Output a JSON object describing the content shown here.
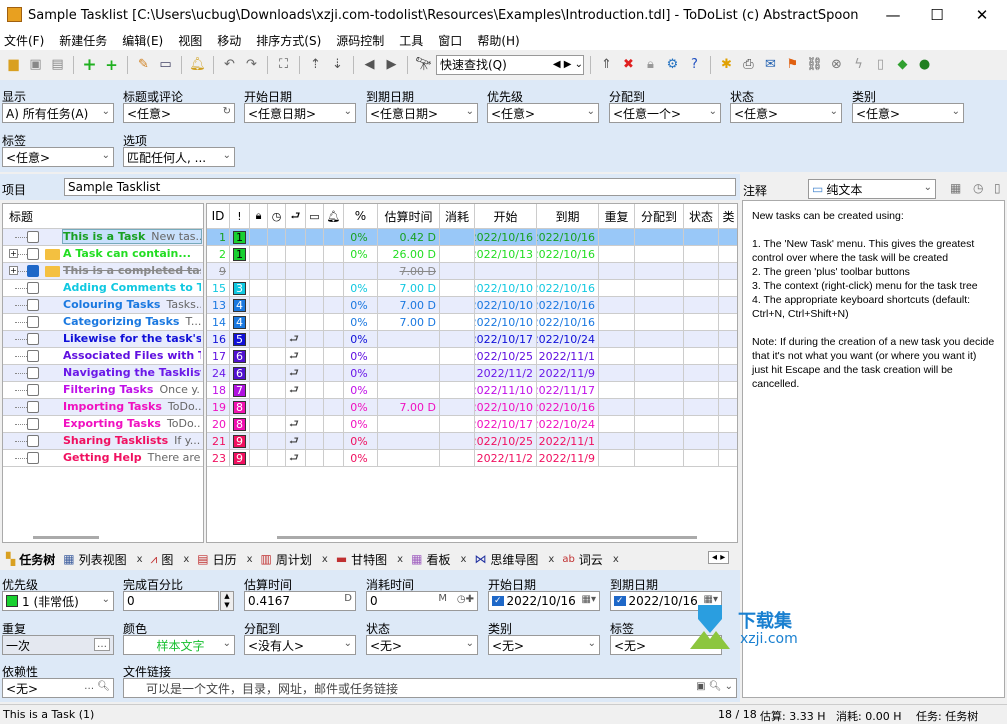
{
  "window": {
    "title": "Sample Tasklist [C:\\Users\\ucbug\\Downloads\\xzji.com-todolist\\Resources\\Examples\\Introduction.tdl] - ToDoList (c) AbstractSpoon"
  },
  "menu": [
    "文件(F)",
    "新建任务",
    "编辑(E)",
    "视图",
    "移动",
    "排序方式(S)",
    "源码控制",
    "工具",
    "窗口",
    "帮助(H)"
  ],
  "toolbar": {
    "quick_find": "快速查找(Q)"
  },
  "filters": [
    {
      "label": "显示",
      "value": "A)  所有任务(A)"
    },
    {
      "label": "标题或评论",
      "value": "<任意>"
    },
    {
      "label": "开始日期",
      "value": "<任意日期>"
    },
    {
      "label": "到期日期",
      "value": "<任意日期>"
    },
    {
      "label": "优先级",
      "value": "<任意>"
    },
    {
      "label": "分配到",
      "value": "<任意一个>"
    },
    {
      "label": "状态",
      "value": "<任意>"
    },
    {
      "label": "类别",
      "value": "<任意>"
    },
    {
      "label": "标签",
      "value": "<任意>"
    },
    {
      "label": "选项",
      "value": "匹配任何人, ..."
    }
  ],
  "project": {
    "label": "项目",
    "value": "Sample Tasklist"
  },
  "comments": {
    "label": "注释",
    "format": "纯文本",
    "text": "New tasks can be created using:\n\n1. The 'New Task' menu. This gives the greatest control over where the task will be created\n2. The green 'plus' toolbar buttons\n3. The context (right-click) menu for the task tree\n4. The appropriate keyboard shortcuts (default: Ctrl+N, Ctrl+Shift+N)\n\nNote: If during the creation of a new task you decide that it's not what you want (or where you want it) just hit Escape and the task creation will be cancelled."
  },
  "tree_header": "标题",
  "columns": [
    "ID",
    "!",
    "lock",
    "clock",
    "dep",
    "folder",
    "bell",
    "%",
    "估算时间",
    "消耗",
    "开始",
    "到期",
    "重复",
    "分配到",
    "状态",
    "类"
  ],
  "tasks": [
    {
      "title": "This is a Task",
      "comment": "New tas...",
      "id": "1",
      "priority": "1",
      "pct": "0%",
      "est": "0.42 D",
      "start": "2022/10/16",
      "due": "2022/10/16",
      "color": "#18a020",
      "pcolor": "#18d030",
      "selected": true
    },
    {
      "title": "A Task can contain...",
      "comment": "",
      "id": "2",
      "priority": "1",
      "pct": "0%",
      "est": "26.00 D",
      "start": "2022/10/13",
      "due": "2022/10/16",
      "color": "#22dd22",
      "pcolor": "#18d030",
      "folder": true,
      "expand": true
    },
    {
      "title": "This is a completed task",
      "comment": "",
      "id": "9",
      "priority": "",
      "pct": "",
      "est": "7.00 D",
      "start": "",
      "due": "",
      "color": "#888888",
      "done": true,
      "folder": true,
      "expand": true
    },
    {
      "title": "Adding Comments to T...",
      "comment": "",
      "id": "15",
      "priority": "3",
      "pct": "0%",
      "est": "7.00 D",
      "start": "2022/10/10",
      "due": "2022/10/16",
      "color": "#10c8e0",
      "pcolor": "#10c8e0"
    },
    {
      "title": "Colouring Tasks",
      "comment": "Tasks...",
      "id": "13",
      "priority": "4",
      "pct": "0%",
      "est": "7.00 D",
      "start": "2022/10/10",
      "due": "2022/10/16",
      "color": "#1a78e0",
      "pcolor": "#1a78e0"
    },
    {
      "title": "Categorizing Tasks",
      "comment": "T...",
      "id": "14",
      "priority": "4",
      "pct": "0%",
      "est": "7.00 D",
      "start": "2022/10/10",
      "due": "2022/10/16",
      "color": "#1a78e0",
      "pcolor": "#1a78e0"
    },
    {
      "title": "Likewise for the task's ...",
      "comment": "",
      "id": "16",
      "priority": "5",
      "pct": "0%",
      "est": "",
      "start": "2022/10/17",
      "due": "2022/10/24",
      "color": "#1010d8",
      "pcolor": "#1010d8",
      "dep": true
    },
    {
      "title": "Associated Files with T...",
      "comment": "",
      "id": "17",
      "priority": "6",
      "pct": "0%",
      "est": "",
      "start": "2022/10/25",
      "due": "2022/11/1",
      "color": "#6010e0",
      "pcolor": "#5010d0",
      "dep": true
    },
    {
      "title": "Navigating the Tasklist",
      "comment": "",
      "id": "24",
      "priority": "6",
      "pct": "0%",
      "est": "",
      "start": "2022/11/2",
      "due": "2022/11/9",
      "color": "#6a18e8",
      "pcolor": "#5010d0",
      "dep": true
    },
    {
      "title": "Filtering Tasks",
      "comment": "Once y...",
      "id": "18",
      "priority": "7",
      "pct": "0%",
      "est": "",
      "start": "2022/11/10",
      "due": "2022/11/17",
      "color": "#c010e8",
      "pcolor": "#b010e0",
      "dep": true
    },
    {
      "title": "Importing Tasks",
      "comment": "ToDo...",
      "id": "19",
      "priority": "8",
      "pct": "0%",
      "est": "7.00 D",
      "start": "2022/10/10",
      "due": "2022/10/16",
      "color": "#f010c0",
      "pcolor": "#f010b0"
    },
    {
      "title": "Exporting Tasks",
      "comment": "ToDo...",
      "id": "20",
      "priority": "8",
      "pct": "0%",
      "est": "",
      "start": "2022/10/17",
      "due": "2022/10/24",
      "color": "#f010c0",
      "pcolor": "#f010b0",
      "dep": true
    },
    {
      "title": "Sharing Tasklists",
      "comment": "If y...",
      "id": "21",
      "priority": "9",
      "pct": "0%",
      "est": "",
      "start": "2022/10/25",
      "due": "2022/11/1",
      "color": "#f01060",
      "pcolor": "#f01060",
      "dep": true
    },
    {
      "title": "Getting Help",
      "comment": "There are...",
      "id": "23",
      "priority": "9",
      "pct": "0%",
      "est": "",
      "start": "2022/11/2",
      "due": "2022/11/9",
      "color": "#f01060",
      "pcolor": "#f01060",
      "dep": true
    }
  ],
  "tabs": [
    "任务树",
    "列表视图",
    "图",
    "日历",
    "周计划",
    "甘特图",
    "看板",
    "思维导图",
    "词云"
  ],
  "detail": {
    "priority": {
      "label": "优先级",
      "value": "1 (非常低)"
    },
    "percent": {
      "label": "完成百分比",
      "value": "0"
    },
    "estimate": {
      "label": "估算时间",
      "value": "0.4167",
      "unit": "D"
    },
    "spent": {
      "label": "消耗时间",
      "value": "0",
      "unit": "M"
    },
    "start": {
      "label": "开始日期",
      "value": "2022/10/16"
    },
    "due": {
      "label": "到期日期",
      "value": "2022/10/16"
    },
    "recurrence": {
      "label": "重复",
      "value": "一次"
    },
    "color": {
      "label": "颜色",
      "value": "样本文字"
    },
    "assigned": {
      "label": "分配到",
      "value": "<没有人>"
    },
    "status": {
      "label": "状态",
      "value": "<无>"
    },
    "category": {
      "label": "类别",
      "value": "<无>"
    },
    "tags": {
      "label": "标签",
      "value": "<无>"
    },
    "depends": {
      "label": "依赖性",
      "value": "<无>"
    },
    "filelink": {
      "label": "文件链接",
      "placeholder": "可以是一个文件，目录，网址，邮件或任务链接"
    }
  },
  "status": {
    "selected": "This is a Task   (1)",
    "count": "18 / 18",
    "estimate": "估算:  3.33 H",
    "spent": "消耗: 0.00 H",
    "view": "任务: 任务树"
  },
  "watermark": "下载集 xzji.com"
}
